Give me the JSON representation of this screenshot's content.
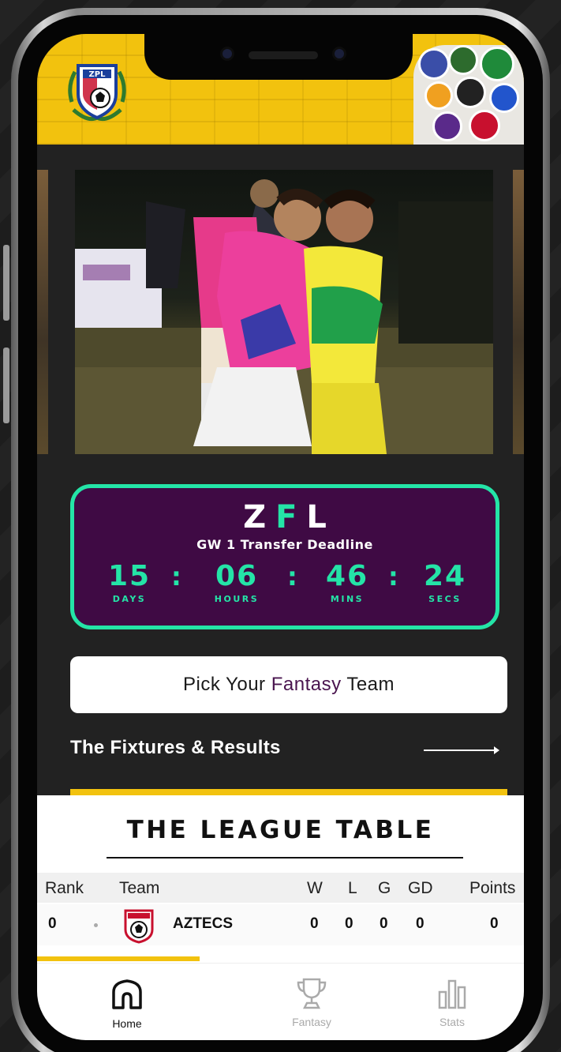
{
  "header": {
    "logo_text": "ZPL",
    "colors": {
      "yellow": "#f2c20e"
    }
  },
  "countdown": {
    "brand_letters": [
      "Z",
      "F",
      "L"
    ],
    "deadline_label": "GW 1 Transfer Deadline",
    "units": [
      {
        "value": "15",
        "label": "DAYS"
      },
      {
        "value": "06",
        "label": "HOURS"
      },
      {
        "value": "46",
        "label": "MINS"
      },
      {
        "value": "24",
        "label": "SECS"
      }
    ],
    "separator": ":",
    "colors": {
      "bg": "#3f0a44",
      "accent": "#24e4a7"
    }
  },
  "pick_team": {
    "before": "Pick Your ",
    "highlight": "Fantasy",
    "after": " Team"
  },
  "fixtures": {
    "label": "The Fixtures & Results"
  },
  "league_table": {
    "title": "THE LEAGUE TABLE",
    "columns": [
      "Rank",
      "Team",
      "W",
      "L",
      "G",
      "GD",
      "Points"
    ],
    "rows": [
      {
        "rank": "0",
        "team": "AZTECS",
        "w": "0",
        "l": "0",
        "g": "0",
        "gd": "0",
        "points": "0"
      }
    ]
  },
  "bottom_nav": {
    "items": [
      {
        "label": "Home",
        "icon": "home-icon",
        "active": true
      },
      {
        "label": "Fantasy",
        "icon": "trophy-icon",
        "active": false
      },
      {
        "label": "Stats",
        "icon": "bar-chart-icon",
        "active": false
      }
    ]
  }
}
